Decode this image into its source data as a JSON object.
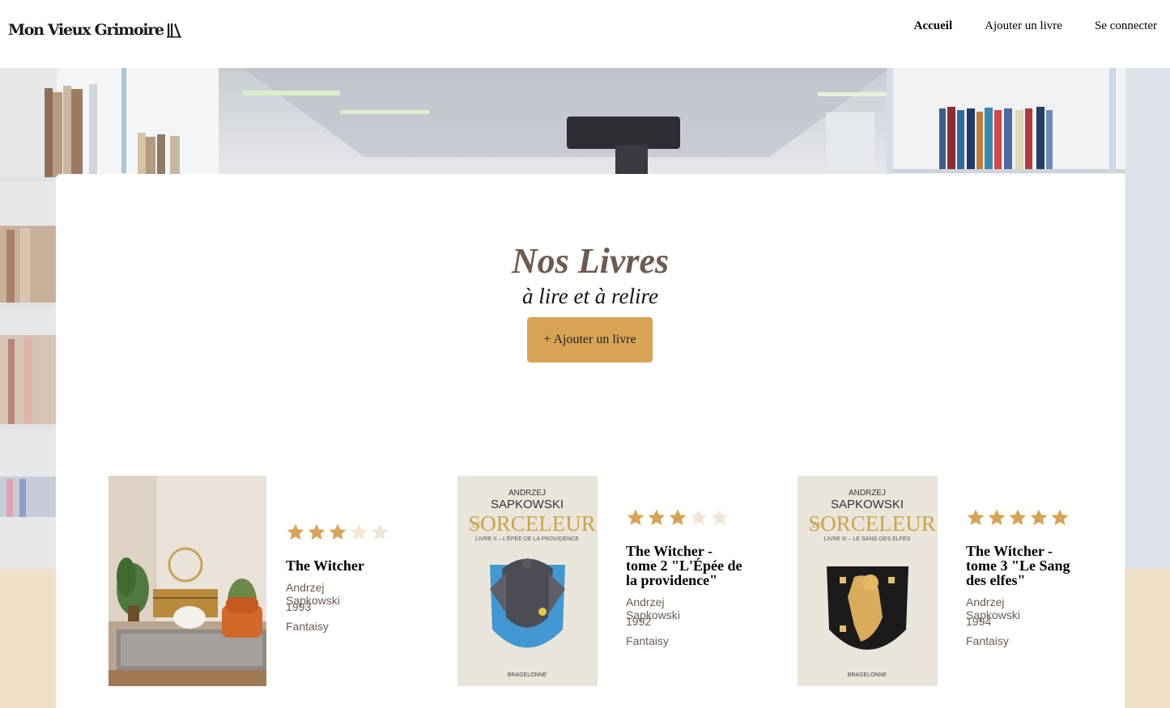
{
  "header": {
    "logo_text": "Mon Vieux Grimoire",
    "nav": [
      {
        "label": "Accueil",
        "active": true
      },
      {
        "label": "Ajouter un livre",
        "active": false
      },
      {
        "label": "Se connecter",
        "active": false
      }
    ]
  },
  "main": {
    "title": "Nos Livres",
    "subtitle": "à lire et à relire",
    "add_button_label": "+ Ajouter un livre"
  },
  "books": [
    {
      "title": "The Witcher",
      "author": "Andrzej Sapkowski",
      "year": "1993",
      "genre": "Fantaisy",
      "rating": 3
    },
    {
      "title": "The Witcher - tome 2 \"L'Épée de la providence\"",
      "author": "Andrzej Sapkowski",
      "year": "1992",
      "genre": "Fantaisy",
      "rating": 3,
      "cover": {
        "author_first": "ANDRZEJ",
        "author_last": "SAPKOWSKI",
        "series_le": "LE",
        "series": "SORCELEUR",
        "subtitle": "LIVRE II – L'ÉPÉE DE LA PROVIDENCE",
        "publisher": "BRAGELONNE"
      }
    },
    {
      "title": "The Witcher - tome 3 \"Le Sang des elfes\"",
      "author": "Andrzej Sapkowski",
      "year": "1994",
      "genre": "Fantaisy",
      "rating": 5,
      "cover": {
        "author_first": "ANDRZEJ",
        "author_last": "SAPKOWSKI",
        "series_le": "LE",
        "series": "SORCELEUR",
        "subtitle": "LIVRE III – LE SANG DES ELFES",
        "publisher": "BRAGELONNE"
      }
    }
  ],
  "colors": {
    "accent": "#d6a454",
    "star_filled": "#d6a454",
    "star_empty": "#f3e6d2",
    "title": "#6e5a4e"
  }
}
